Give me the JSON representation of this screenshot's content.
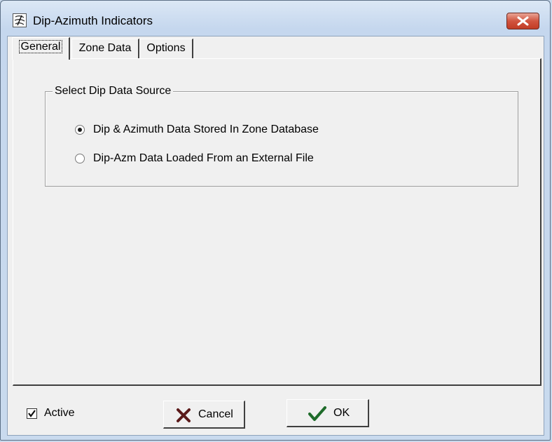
{
  "window": {
    "title": "Dip-Azimuth Indicators"
  },
  "tabs": [
    "General",
    "Zone Data",
    "Options"
  ],
  "group": {
    "legend": "Select Dip Data Source",
    "options": [
      {
        "label": "Dip & Azimuth Data Stored In Zone Database",
        "checked": true
      },
      {
        "label": "Dip-Azm Data Loaded From an External File",
        "checked": false
      }
    ]
  },
  "footer": {
    "active_label": "Active",
    "active_checked": true,
    "cancel_label": "Cancel",
    "ok_label": "OK"
  },
  "colors": {
    "close_button": "#c9463a",
    "ok_check": "#1e6b2a",
    "cancel_x": "#5b1a1a"
  }
}
